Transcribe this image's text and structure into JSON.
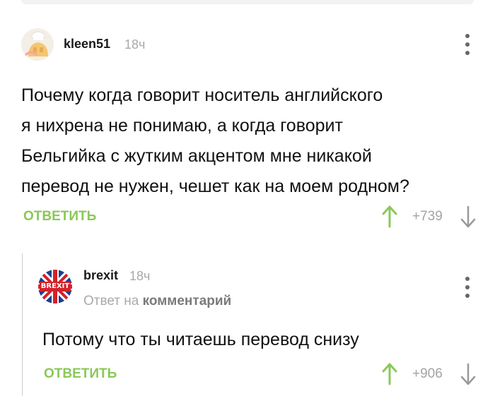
{
  "comments": [
    {
      "username": "kleen51",
      "time": "18ч",
      "text_lines": [
        "Почему когда говорит носитель английского",
        "я нихрена не понимаю, а когда говорит",
        "Бельгийка с жутким акцентом мне никакой",
        "перевод не нужен, чешет как на моем родном?"
      ],
      "reply_label": "ОТВЕТИТЬ",
      "score": "+739",
      "icons": {
        "avatar": "chef-avatar-icon",
        "menu": "kebab-menu-icon",
        "up": "arrow-up-icon",
        "down": "arrow-down-icon"
      }
    },
    {
      "username": "brexit",
      "time": "18ч",
      "reply_to_prefix": "Ответ на",
      "reply_to_link": "комментарий",
      "avatar_text": "BREXIT",
      "text_lines": [
        "Потому что ты читаешь перевод снизу"
      ],
      "reply_label": "ОТВЕТИТЬ",
      "score": "+906",
      "icons": {
        "avatar": "union-jack-avatar-icon",
        "menu": "kebab-menu-icon",
        "up": "arrow-up-icon",
        "down": "arrow-down-icon"
      }
    }
  ],
  "colors": {
    "accent_green": "#8ac858",
    "muted": "#a9a9a9",
    "text": "#111111",
    "thread_line": "#cfcfcf"
  }
}
